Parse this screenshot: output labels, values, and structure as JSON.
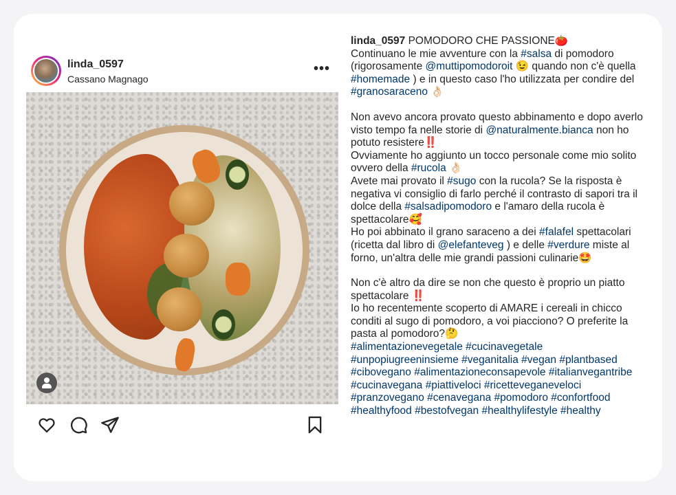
{
  "post": {
    "username": "linda_0597",
    "location": "Cassano Magnago",
    "more_label": "•••"
  },
  "caption": {
    "title": "POMODORO CHE PASSIONE🍅",
    "p1": [
      "Continuano le mie avventure con la ",
      "#salsa",
      " di pomodoro (rigorosamente ",
      "@muttipomodoroit",
      " 😉 quando non c'è quella ",
      "#homemade",
      " ) e in questo caso l'ho utilizzata per condire del ",
      "#granosaraceno",
      " 👌🏻"
    ],
    "p2": [
      "Non avevo ancora provato questo abbinamento e dopo averlo visto tempo fa nelle storie di ",
      "@naturalmente.bianca",
      " non ho potuto resistere‼️"
    ],
    "p3": [
      "Ovviamente ho aggiunto un tocco personale come mio solito ovvero della ",
      "#rucola",
      " 👌🏻"
    ],
    "p4": [
      "Avete mai provato il ",
      "#sugo",
      " con la rucola? Se la risposta è negativa vi consiglio di farlo perché il contrasto di sapori tra il dolce della ",
      "#salsadipomodoro",
      " e l'amaro della rucola è spettacolare🥰"
    ],
    "p5": [
      "Ho poi abbinato il grano saraceno a dei ",
      "#falafel",
      " spettacolari (ricetta dal libro di ",
      "@elefanteveg",
      " ) e delle ",
      "#verdure",
      " miste al forno, un'altra delle mie grandi passioni culinarie🤩"
    ],
    "p6": "Non c'è altro da dire se non che questo è proprio un piatto spettacolare ‼️",
    "p7": "Io ho recentemente scoperto di AMARE i cereali in chicco conditi al sugo di pomodoro, a voi piacciono? O preferite la pasta al pomodoro?🤔",
    "hashtags": "#alimentazionevegetale #cucinavegetale #unpopiugreeninsieme #veganitalia #vegan #plantbased #cibovegano #alimentazioneconsapevole #italianvegantribe #cucinavegana #piattiveloci #ricetteveganeveloci #pranzovegano #cenavegana #pomodoro #confortfood #healthyfood #bestofvegan #healthylifestyle #healthy"
  },
  "colors": {
    "link": "#00376b",
    "text": "#262626",
    "background": "#f4f4f6"
  },
  "icons": [
    "more-icon",
    "heart-icon",
    "comment-icon",
    "share-icon",
    "bookmark-icon",
    "user-tag-icon"
  ]
}
